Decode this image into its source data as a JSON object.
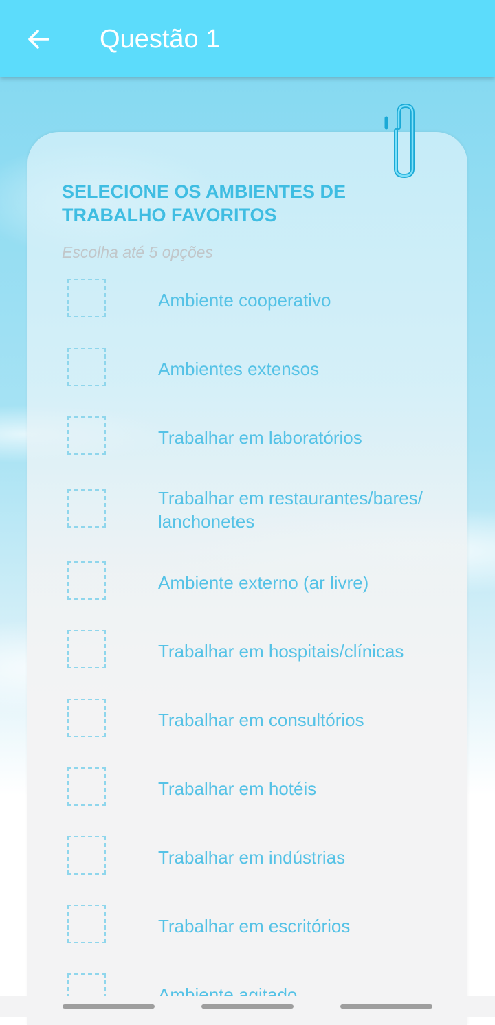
{
  "appbar": {
    "title": "Questão 1",
    "back_icon": "arrow-left-icon"
  },
  "question": {
    "title_line1": "SELECIONE OS AMBIENTES DE",
    "title_line2": "TRABALHO FAVORITOS",
    "hint": "Escolha até 5 opções",
    "clip_icon": "paperclip-icon"
  },
  "options": [
    {
      "label": "Ambiente cooperativo",
      "checked": false
    },
    {
      "label": "Ambientes extensos",
      "checked": false
    },
    {
      "label": "Trabalhar em laboratórios",
      "checked": false
    },
    {
      "label": "Trabalhar em restaurantes/bares/ lanchonetes",
      "checked": false
    },
    {
      "label": "Ambiente externo (ar livre)",
      "checked": false
    },
    {
      "label": "Trabalhar em hospitais/clínicas",
      "checked": false
    },
    {
      "label": "Trabalhar em consultórios",
      "checked": false
    },
    {
      "label": "Trabalhar em hotéis",
      "checked": false
    },
    {
      "label": "Trabalhar em indústrias",
      "checked": false
    },
    {
      "label": "Trabalhar em escritórios",
      "checked": false
    },
    {
      "label": "Ambiente agitado",
      "checked": false
    }
  ],
  "colors": {
    "appbar": "#5cdcfb",
    "accent_text": "#3fbde2",
    "option_text": "#55c2e6",
    "checkbox_border": "#8fd6ec",
    "hint_text": "#c1c6c9"
  }
}
